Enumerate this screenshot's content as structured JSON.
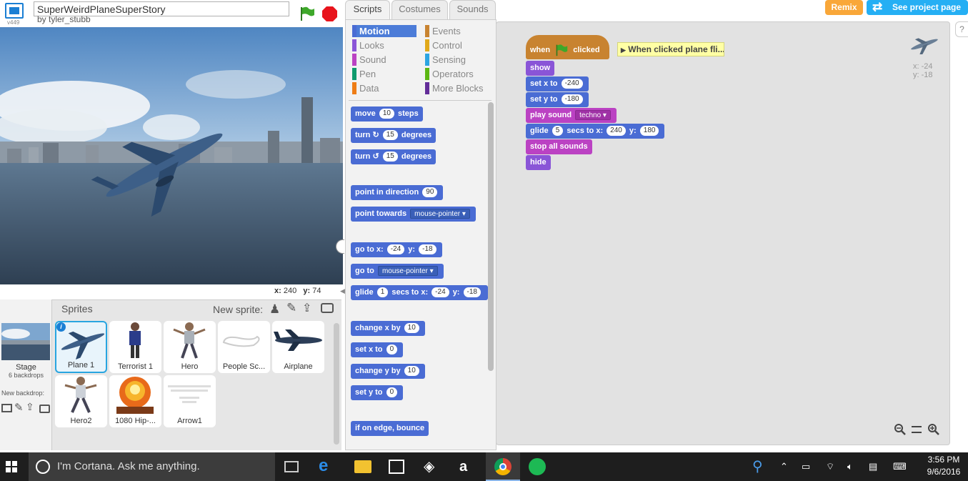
{
  "project": {
    "title": "SuperWeirdPlaneSuperStory",
    "author": "by tyler_stubb",
    "version": "v449"
  },
  "stage": {
    "coords_x_label": "x:",
    "coords_x": "240",
    "coords_y_label": "y:",
    "coords_y": "74"
  },
  "sprites_panel": {
    "title": "Sprites",
    "new_sprite_label": "New sprite:",
    "stage_label": "Stage",
    "stage_backdrops": "6 backdrops",
    "new_backdrop_label": "New backdrop:",
    "sprites": [
      {
        "name": "Plane 1"
      },
      {
        "name": "Terrorist 1"
      },
      {
        "name": "Hero"
      },
      {
        "name": "People Sc..."
      },
      {
        "name": "Airplane"
      },
      {
        "name": "Hero2"
      },
      {
        "name": "1080 Hip-..."
      },
      {
        "name": "Arrow1"
      }
    ]
  },
  "tabs": [
    "Scripts",
    "Costumes",
    "Sounds"
  ],
  "categories": [
    {
      "label": "Motion",
      "color": "#4a6cd4"
    },
    {
      "label": "Events",
      "color": "#c88330"
    },
    {
      "label": "Looks",
      "color": "#8a55d7"
    },
    {
      "label": "Control",
      "color": "#e1a91a"
    },
    {
      "label": "Sound",
      "color": "#bb42c3"
    },
    {
      "label": "Sensing",
      "color": "#2ca5e2"
    },
    {
      "label": "Pen",
      "color": "#0e9a6c"
    },
    {
      "label": "Operators",
      "color": "#5cb712"
    },
    {
      "label": "Data",
      "color": "#ee7d16"
    },
    {
      "label": "More Blocks",
      "color": "#632d99"
    }
  ],
  "palette_blocks": {
    "move": "move",
    "move_val": "10",
    "steps": "steps",
    "turn": "turn",
    "turn_cw_val": "15",
    "turn_ccw_val": "15",
    "degrees": "degrees",
    "point_in_direction": "point in direction",
    "direction_val": "90",
    "point_towards": "point towards",
    "towards_val": "mouse-pointer",
    "go_to_x": "go to x:",
    "go_x": "-24",
    "y": "y:",
    "go_y": "-18",
    "go_to": "go to",
    "go_to_val": "mouse-pointer",
    "glide": "glide",
    "glide_secs": "1",
    "secs_to_x": "secs to x:",
    "glide_x": "-24",
    "glide_y": "-18",
    "change_x_by": "change x by",
    "change_x_val": "10",
    "set_x_to": "set x to",
    "set_x_val": "0",
    "change_y_by": "change y by",
    "change_y_val": "10",
    "set_y_to": "set y to",
    "set_y_val": "0",
    "if_on_edge": "if on edge, bounce"
  },
  "script": {
    "when": "when",
    "clicked": "clicked",
    "comment": "When clicked plane fli...",
    "show": "show",
    "set_x_to": "set x to",
    "set_x_val": "-240",
    "set_y_to": "set y to",
    "set_y_val": "-180",
    "play_sound": "play sound",
    "sound_val": "techno",
    "glide": "glide",
    "glide_secs": "5",
    "secs_to_x": "secs to x:",
    "glide_x": "240",
    "y": "y:",
    "glide_y": "180",
    "stop_all_sounds": "stop all sounds",
    "hide": "hide"
  },
  "sprite_info": {
    "x": "x: -24",
    "y": "y: -18"
  },
  "header_buttons": {
    "remix": "Remix",
    "see_project": "See project page"
  },
  "taskbar": {
    "cortana": "I'm Cortana. Ask me anything.",
    "time": "3:56 PM",
    "date": "9/6/2016"
  }
}
